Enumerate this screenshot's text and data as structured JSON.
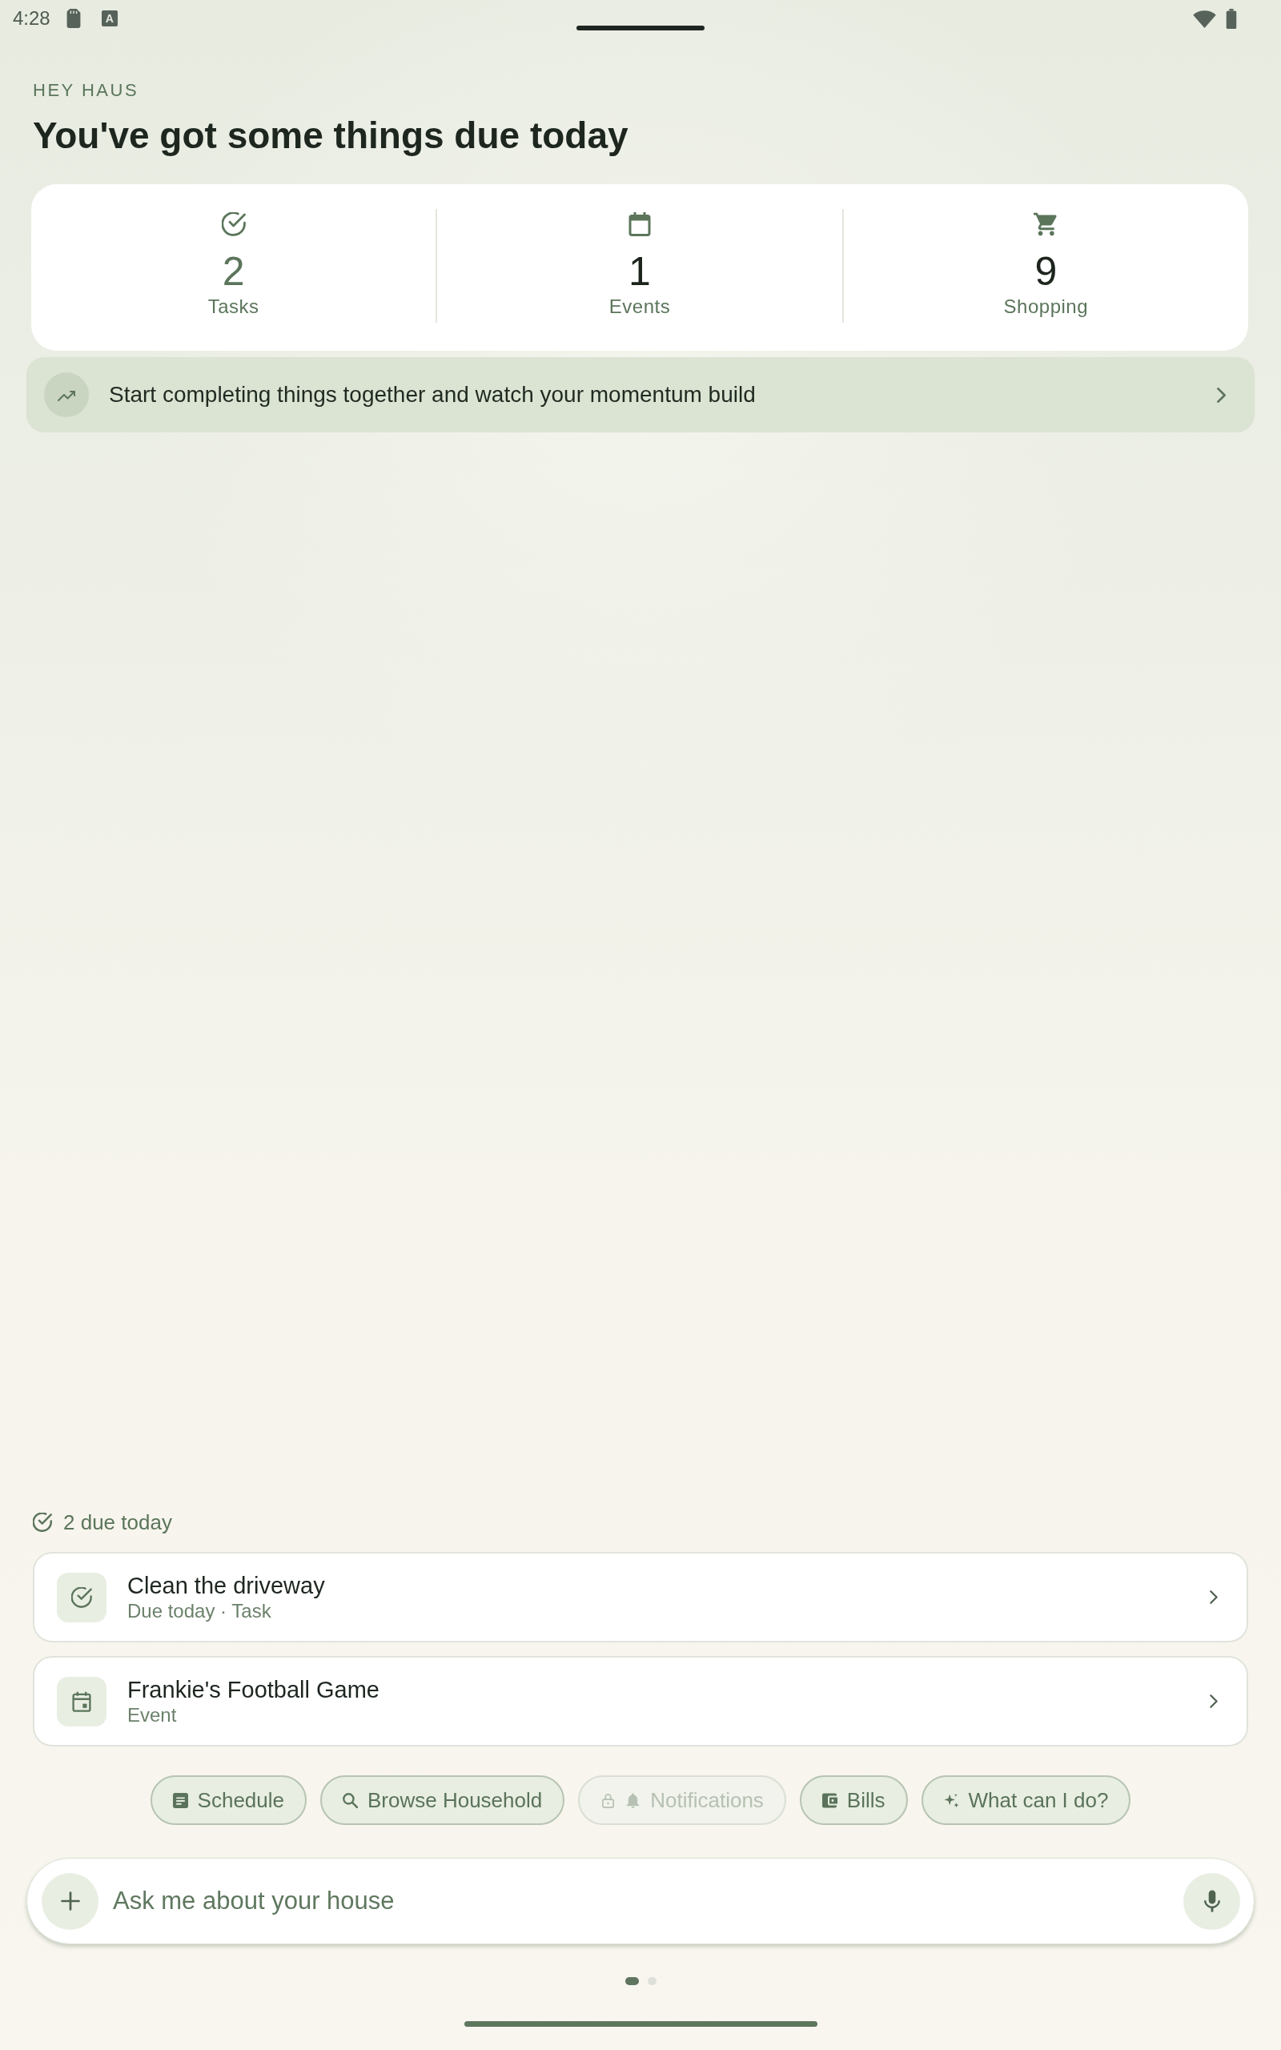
{
  "status_bar": {
    "time": "4:28",
    "badge": "A"
  },
  "header": {
    "eyebrow": "HEY HAUS",
    "title": "You've got some things due today"
  },
  "summary": [
    {
      "kind": "tasks",
      "count": "2",
      "label": "Tasks",
      "color": "#5b755b"
    },
    {
      "kind": "events",
      "count": "1",
      "label": "Events",
      "color": "#1c241c"
    },
    {
      "kind": "shopping",
      "count": "9",
      "label": "Shopping",
      "color": "#1c241c"
    }
  ],
  "momentum_banner": {
    "text": "Start completing things together and watch your momentum build"
  },
  "due_today": {
    "label": "2 due today",
    "items": [
      {
        "kind": "task",
        "title": "Clean the driveway",
        "subtitle": "Due today · Task"
      },
      {
        "kind": "event",
        "title": "Frankie's Football Game",
        "subtitle": "Event"
      }
    ]
  },
  "quick_actions": [
    {
      "kind": "schedule",
      "label": "Schedule",
      "disabled": false
    },
    {
      "kind": "search",
      "label": "Browse Household",
      "disabled": false
    },
    {
      "kind": "notifications",
      "label": "Notifications",
      "disabled": true
    },
    {
      "kind": "bills",
      "label": "Bills",
      "disabled": false
    },
    {
      "kind": "sparkle",
      "label": "What can I do?",
      "disabled": false
    }
  ],
  "composer": {
    "placeholder": "Ask me about your house"
  },
  "pager": [
    {
      "selected": true
    },
    {
      "selected": false
    }
  ]
}
